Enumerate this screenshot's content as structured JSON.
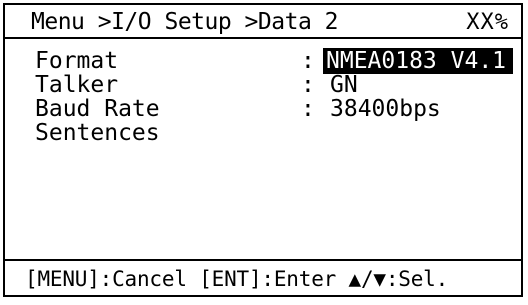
{
  "header": {
    "breadcrumb": "Menu >I/O Setup >Data 2",
    "percent": "XX%"
  },
  "settings": [
    {
      "label": "Format",
      "value": "NMEA0183 V4.1",
      "selected": true
    },
    {
      "label": "Talker",
      "value": "GN",
      "selected": false
    },
    {
      "label": "Baud Rate",
      "value": "38400bps",
      "selected": false
    },
    {
      "label": "Sentences",
      "value": "",
      "selected": false
    }
  ],
  "colon": ":",
  "footer": {
    "hint": "[MENU]:Cancel [ENT]:Enter ▲/▼:Sel."
  },
  "colors": {
    "background": "#ffffff",
    "foreground": "#000000",
    "highlight_bg": "#000000",
    "highlight_fg": "#ffffff"
  }
}
